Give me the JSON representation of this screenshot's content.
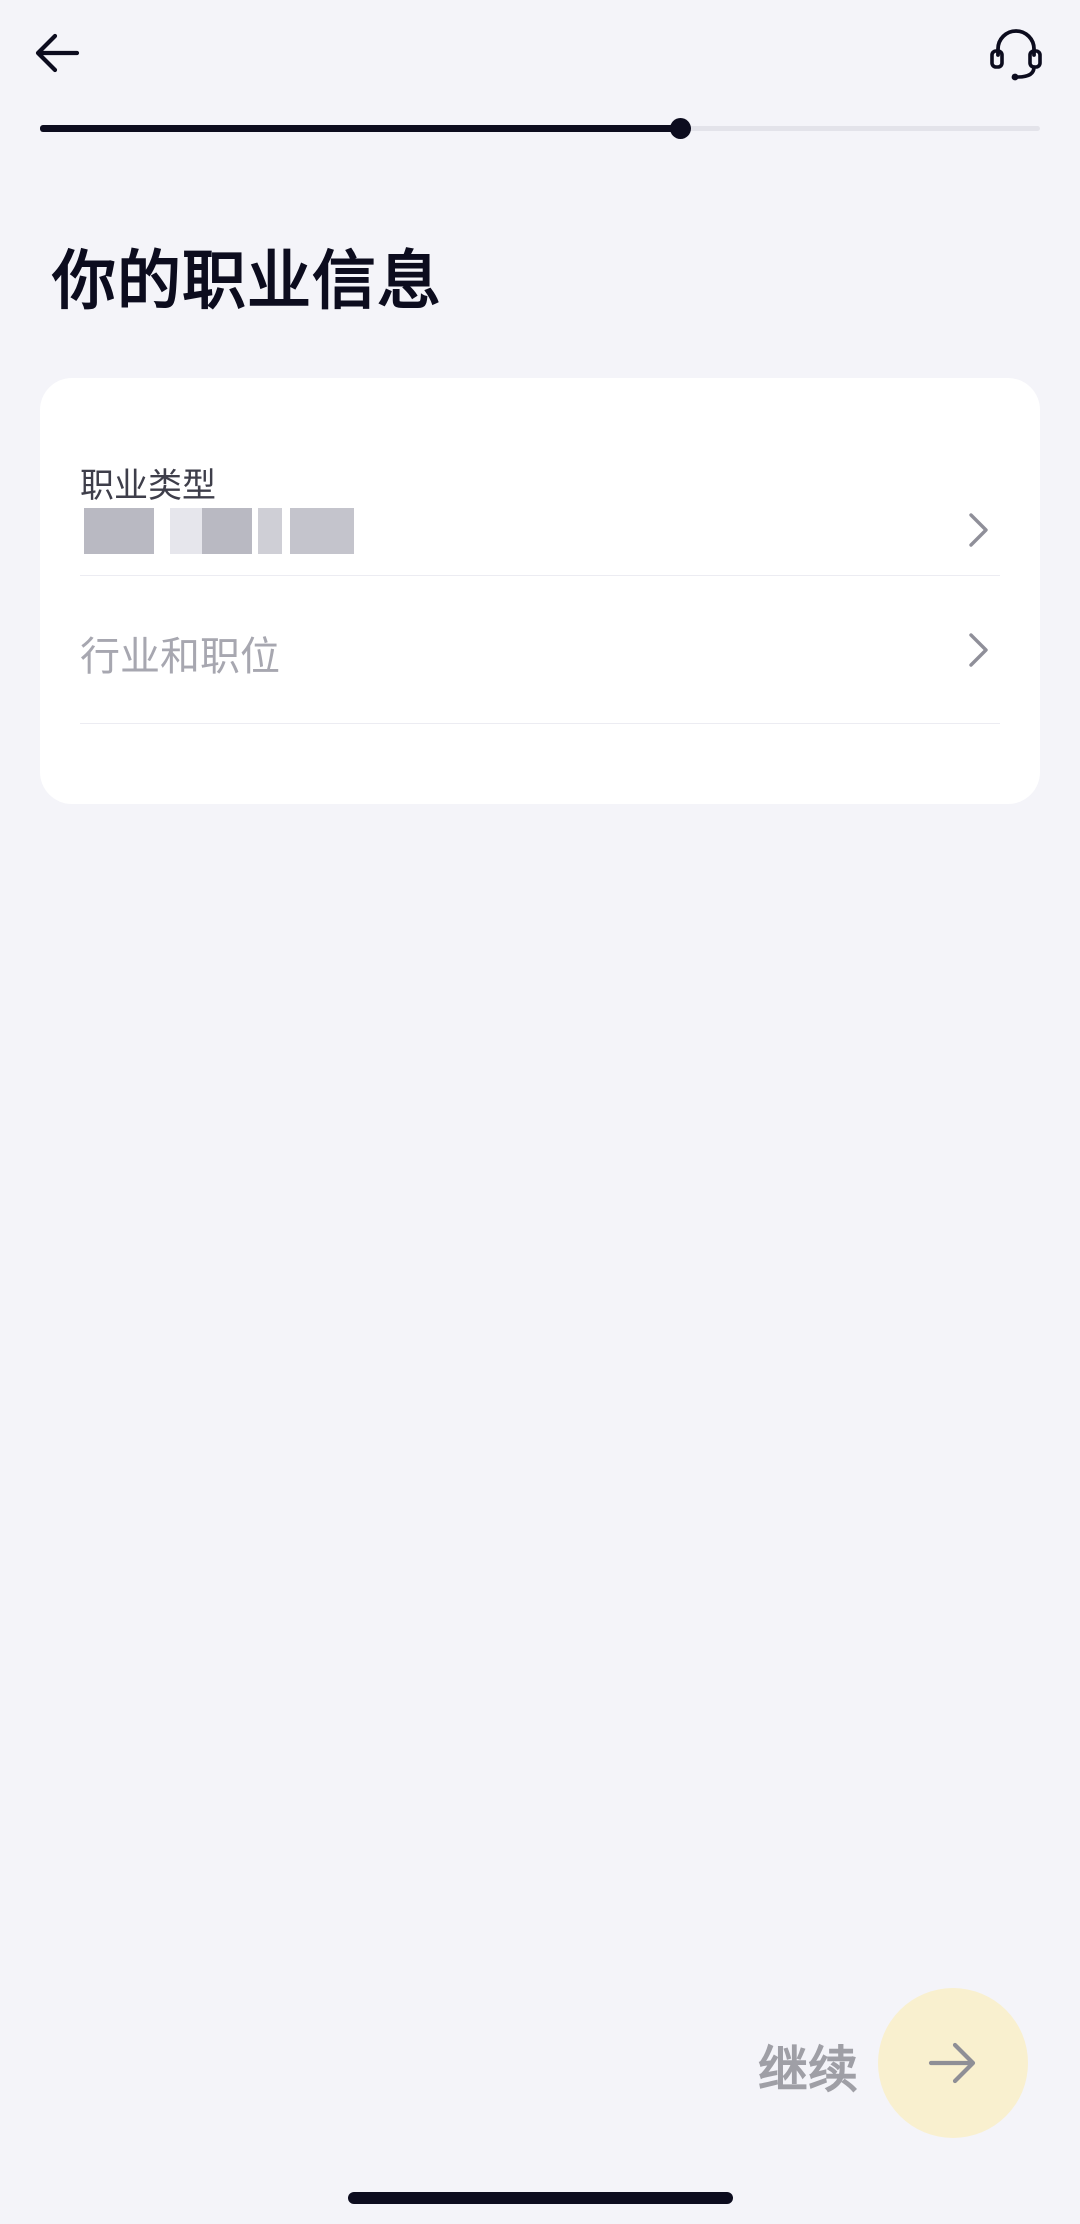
{
  "header": {
    "back_icon": "arrow-left-icon",
    "support_icon": "headset-icon"
  },
  "progress": {
    "fraction": 0.64
  },
  "title": "你的职业信息",
  "form": {
    "occupation": {
      "label": "职业类型",
      "value_blurred": true
    },
    "industry": {
      "placeholder": "行业和职位"
    }
  },
  "footer": {
    "continue_label": "继续",
    "continue_icon": "arrow-right-icon"
  },
  "colors": {
    "background": "#f4f4f9",
    "text_primary": "#0c0c1e",
    "continue_button_bg": "#f9f0cf",
    "disabled_text": "#9f9fa6"
  }
}
